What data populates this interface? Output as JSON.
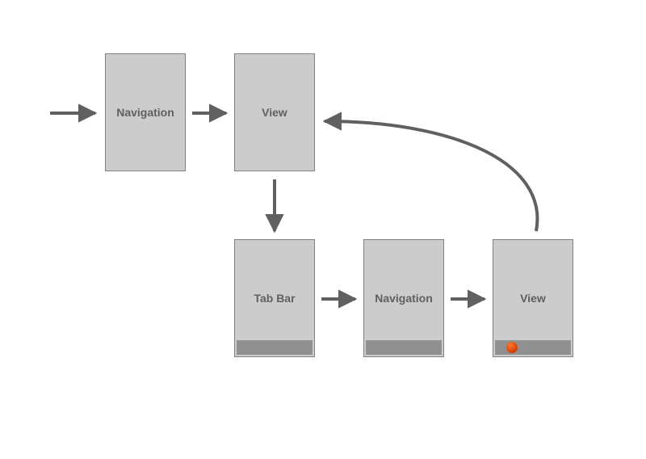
{
  "nodes": {
    "nav1": {
      "label": "Navigation"
    },
    "view1": {
      "label": "View"
    },
    "tabbar": {
      "label": "Tab Bar"
    },
    "nav2": {
      "label": "Navigation"
    },
    "view2": {
      "label": "View"
    }
  },
  "diagram": {
    "edges": [
      {
        "from": "entry",
        "to": "nav1"
      },
      {
        "from": "nav1",
        "to": "view1"
      },
      {
        "from": "view1",
        "to": "tabbar"
      },
      {
        "from": "tabbar",
        "to": "nav2"
      },
      {
        "from": "nav2",
        "to": "view2"
      },
      {
        "from": "view2",
        "to": "view1",
        "note": "curved back-edge"
      }
    ],
    "bottom_row_has_tabbar_strip": true,
    "selected_tab_indicator_on": "view2"
  }
}
